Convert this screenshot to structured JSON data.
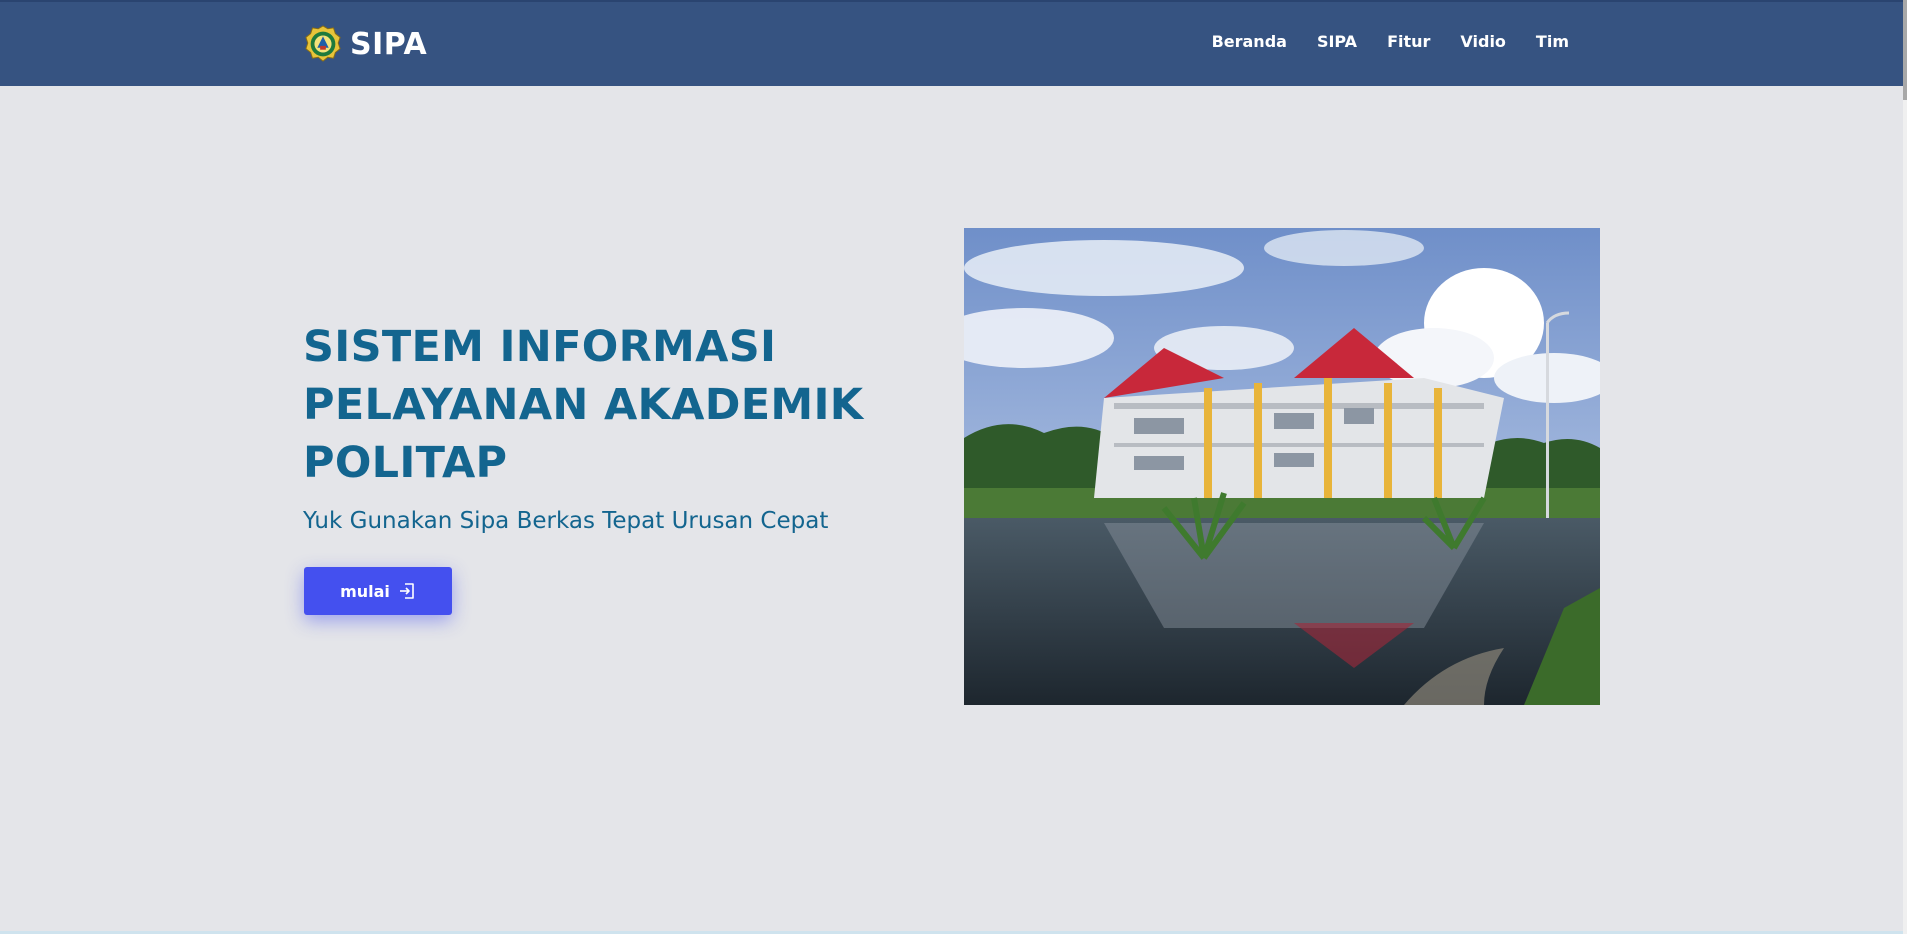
{
  "navbar": {
    "brand_name": "SIPA",
    "logo_icon": "university-emblem-icon",
    "links": [
      "Beranda",
      "SIPA",
      "Fitur",
      "Vidio",
      "Tim"
    ]
  },
  "hero": {
    "title_lines": [
      "SISTEM INFORMASI",
      "PELAYANAN AKADEMIK",
      "POLITAP"
    ],
    "subtitle": "Yuk Gunakan Sipa Berkas Tepat Urusan Cepat",
    "cta_label": "mulai",
    "cta_icon": "login-arrow-icon",
    "photo_icon": "campus-building-photo"
  },
  "colors": {
    "navbar_bg": "#365381",
    "page_bg": "#e4e5e9",
    "title_color": "#13658f",
    "button_bg": "#4450ef"
  }
}
